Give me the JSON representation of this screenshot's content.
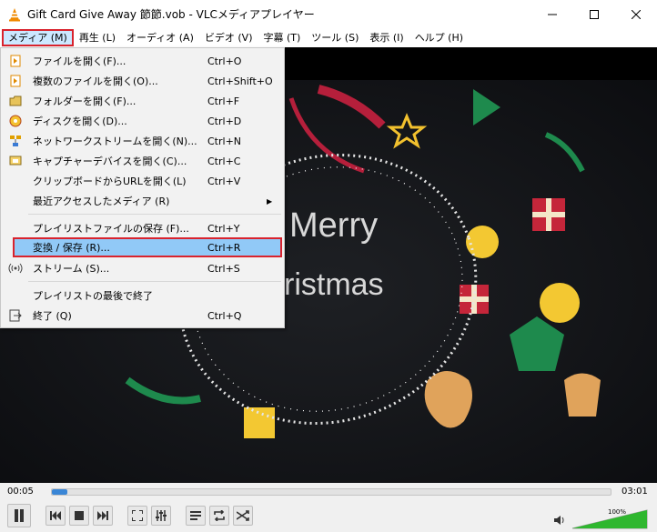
{
  "window": {
    "title": "Gift Card Give Away 節節.vob - VLCメディアプレイヤー",
    "icon": "vlc-cone-icon",
    "controls": [
      "minimize-icon",
      "maximize-icon",
      "close-icon"
    ]
  },
  "menubar": {
    "items": [
      {
        "label": "メディア (M)",
        "active": true
      },
      {
        "label": "再生 (L)"
      },
      {
        "label": "オーディオ (A)"
      },
      {
        "label": "ビデオ (V)"
      },
      {
        "label": "字幕 (T)"
      },
      {
        "label": "ツール (S)"
      },
      {
        "label": "表示 (I)"
      },
      {
        "label": "ヘルプ (H)"
      }
    ]
  },
  "media_menu": {
    "items": [
      {
        "label": "ファイルを開く(F)...",
        "shortcut": "Ctrl+O",
        "icon": "open-file-icon"
      },
      {
        "label": "複数のファイルを開く(O)...",
        "shortcut": "Ctrl+Shift+O",
        "icon": "open-files-icon"
      },
      {
        "label": "フォルダーを開く(F)...",
        "shortcut": "Ctrl+F",
        "icon": "folder-icon"
      },
      {
        "label": "ディスクを開く(D)...",
        "shortcut": "Ctrl+D",
        "icon": "disc-icon"
      },
      {
        "label": "ネットワークストリームを開く(N)...",
        "shortcut": "Ctrl+N",
        "icon": "network-icon"
      },
      {
        "label": "キャプチャーデバイスを開く(C)...",
        "shortcut": "Ctrl+C",
        "icon": "capture-device-icon"
      },
      {
        "label": "クリップボードからURLを開く(L)",
        "shortcut": "Ctrl+V",
        "icon": ""
      },
      {
        "label": "最近アクセスしたメディア (R)",
        "shortcut": "",
        "icon": "",
        "submenu": true
      },
      {
        "label": "プレイリストファイルの保存 (F)...",
        "shortcut": "Ctrl+Y",
        "icon": ""
      },
      {
        "label": "変換 / 保存 (R)...",
        "shortcut": "Ctrl+R",
        "icon": "",
        "highlighted": true
      },
      {
        "label": "ストリーム (S)...",
        "shortcut": "Ctrl+S",
        "icon": "stream-icon"
      },
      {
        "label": "プレイリストの最後で終了",
        "shortcut": "",
        "icon": ""
      },
      {
        "label": "終了 (Q)",
        "shortcut": "Ctrl+Q",
        "icon": "exit-icon"
      }
    ]
  },
  "video": {
    "overlay_line1": "Merry",
    "overlay_line2": "ristmas"
  },
  "playback": {
    "elapsed": "00:05",
    "total": "03:01",
    "progress_fraction": 0.027,
    "volume_label": "100%",
    "volume_fraction": 1.0
  },
  "colors": {
    "highlight": "#91c9f7",
    "annotation_red": "#d9232d",
    "seek_fill": "#3a86d6",
    "volume_fill": "#2fb72f"
  }
}
